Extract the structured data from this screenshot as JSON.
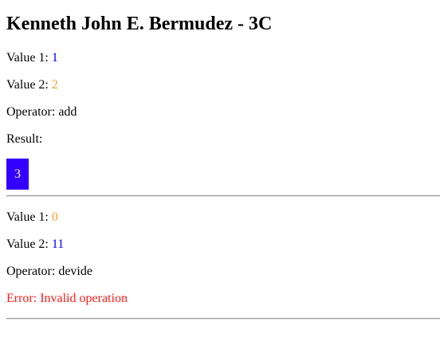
{
  "title": "Kenneth John E. Bermudez - 3C",
  "calc1": {
    "value1_label": "Value 1: ",
    "value1": "1",
    "value2_label": "Value 2: ",
    "value2": "2",
    "operator_label": "Operator: ",
    "operator": "add",
    "result_label": "Result:",
    "result": "3"
  },
  "calc2": {
    "value1_label": "Value 1: ",
    "value1": "0",
    "value2_label": "Value 2: ",
    "value2": "11",
    "operator_label": "Operator: ",
    "operator": "devide",
    "error": "Error: Invalid operation"
  },
  "colors": {
    "blue_value": "#0000ff",
    "orange_value": "#f0a030",
    "result_bg": "#3300ff",
    "error": "#ff1a1a"
  }
}
